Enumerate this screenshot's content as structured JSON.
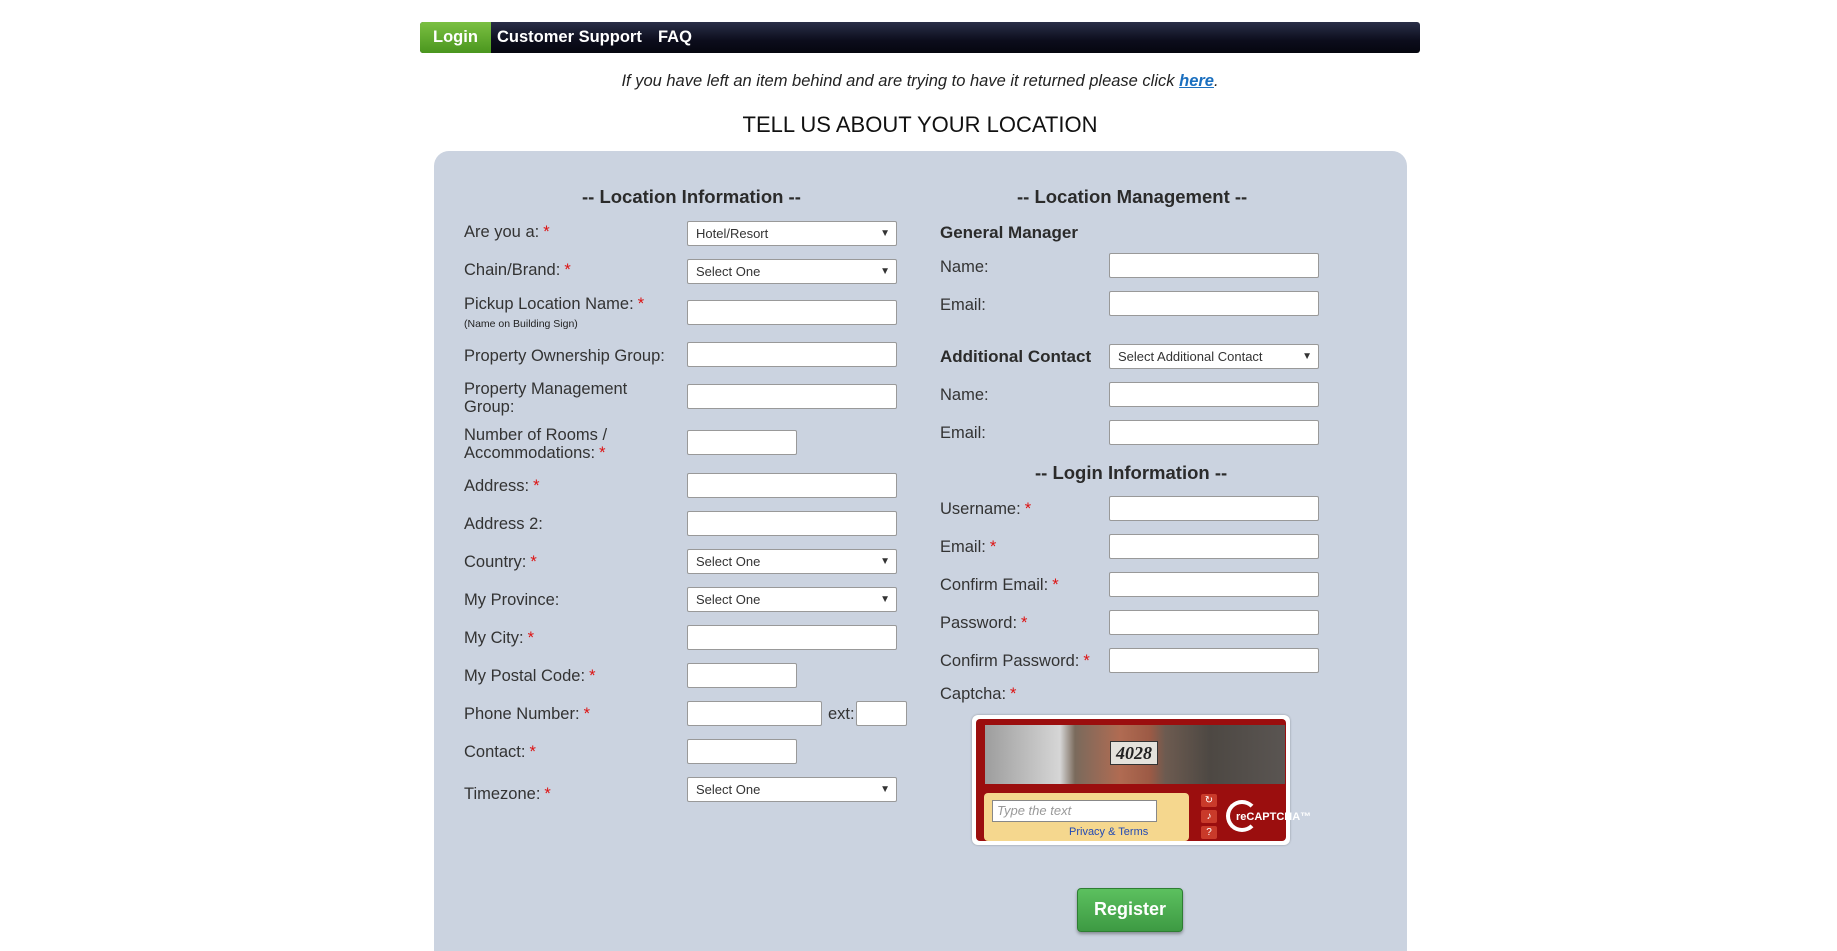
{
  "nav": {
    "login": "Login",
    "support": "Customer Support",
    "faq": "FAQ"
  },
  "notice": {
    "text": "If you have left an item behind and are trying to have it returned please click ",
    "link": "here",
    "end": "."
  },
  "page_title": "TELL US ABOUT YOUR LOCATION",
  "location_info": {
    "heading": "-- Location Information --",
    "are_you": {
      "label": "Are you a:",
      "value": "Hotel/Resort"
    },
    "chain": {
      "label": "Chain/Brand:",
      "value": "Select One"
    },
    "pickup": {
      "label": "Pickup Location Name:",
      "sub": "(Name on Building Sign)"
    },
    "ownership": {
      "label": "Property Ownership Group:"
    },
    "management": {
      "label": "Property Management Group:"
    },
    "rooms": {
      "label": "Number of Rooms / Accommodations:"
    },
    "address": {
      "label": "Address:"
    },
    "address2": {
      "label": "Address 2:"
    },
    "country": {
      "label": "Country:",
      "value": "Select One"
    },
    "province": {
      "label": "My Province:",
      "value": "Select One"
    },
    "city": {
      "label": "My City:"
    },
    "postal": {
      "label": "My Postal Code:"
    },
    "phone": {
      "label": "Phone Number:",
      "ext_label": "ext:"
    },
    "contact": {
      "label": "Contact:"
    },
    "timezone": {
      "label": "Timezone:",
      "value": "Select One"
    }
  },
  "location_mgmt": {
    "heading": "-- Location Management --",
    "gm_heading": "General Manager",
    "gm_name": "Name:",
    "gm_email": "Email:",
    "additional_heading": "Additional Contact",
    "additional_select": "Select Additional Contact",
    "add_name": "Name:",
    "add_email": "Email:"
  },
  "login_info": {
    "heading": "-- Login Information --",
    "username": "Username:",
    "email": "Email:",
    "confirm_email": "Confirm Email:",
    "password": "Password:",
    "confirm_password": "Confirm Password:",
    "captcha": "Captcha:"
  },
  "captcha": {
    "image_text": "4028",
    "placeholder": "Type the text",
    "privacy": "Privacy & Terms",
    "brand": "reCAPTCHA™"
  },
  "register_label": "Register",
  "required_marker": "*"
}
